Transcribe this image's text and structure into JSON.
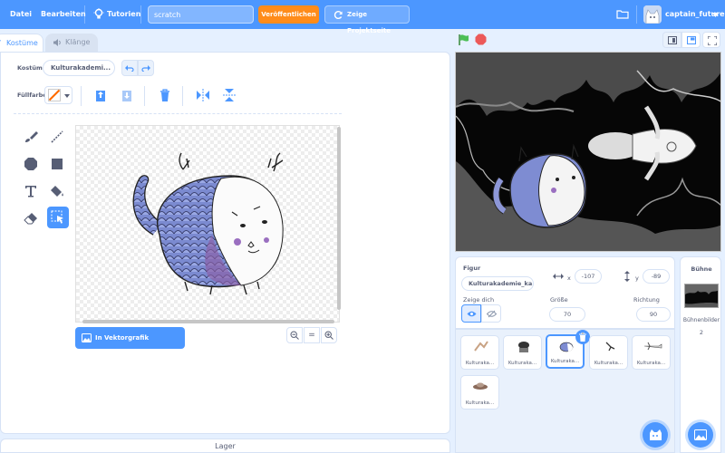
{
  "menu": {
    "file": "Datei",
    "edit": "Bearbeiten",
    "tutorials": "Tutorien",
    "project_title": "scratch",
    "publish": "Veröffentlichen",
    "project_page": "Zeige Projektseite",
    "username": "captain_future"
  },
  "tabs": {
    "costumes": "Kostüme",
    "sounds": "Klänge"
  },
  "editor": {
    "costume_label": "Kostüm",
    "costume_name": "Kulturakademi...",
    "fill_label": "Füllfarbe",
    "convert_button": "In Vektorgrafik umwandeln",
    "zoom_reset": "="
  },
  "backpack": {
    "label": "Lager"
  },
  "sprite_info": {
    "sprite_label": "Figur",
    "sprite_name": "Kulturakademie_ka...",
    "x_label": "x",
    "x_value": "-107",
    "y_label": "y",
    "y_value": "-89",
    "show_label": "Zeige dich",
    "size_label": "Größe",
    "size_value": "70",
    "direction_label": "Richtung",
    "direction_value": "90"
  },
  "sprites": [
    {
      "name": "Kulturaka...",
      "selected": false
    },
    {
      "name": "Kulturaka...",
      "selected": false
    },
    {
      "name": "Kulturaka...",
      "selected": true
    },
    {
      "name": "Kulturaka...",
      "selected": false
    },
    {
      "name": "Kulturaka...",
      "selected": false
    },
    {
      "name": "Kulturaka...",
      "selected": false
    }
  ],
  "stage_panel": {
    "title": "Bühne",
    "backdrops_label": "Bühnenbilder",
    "backdrops_count": "2"
  },
  "colors": {
    "menu_blue": "#4c97ff",
    "publish_orange": "#ff8c1a",
    "fill_color": "#ff6a00",
    "green_flag": "#4cbf56",
    "stop_red": "#ec5959",
    "delete_blue": "#4c97ff"
  }
}
